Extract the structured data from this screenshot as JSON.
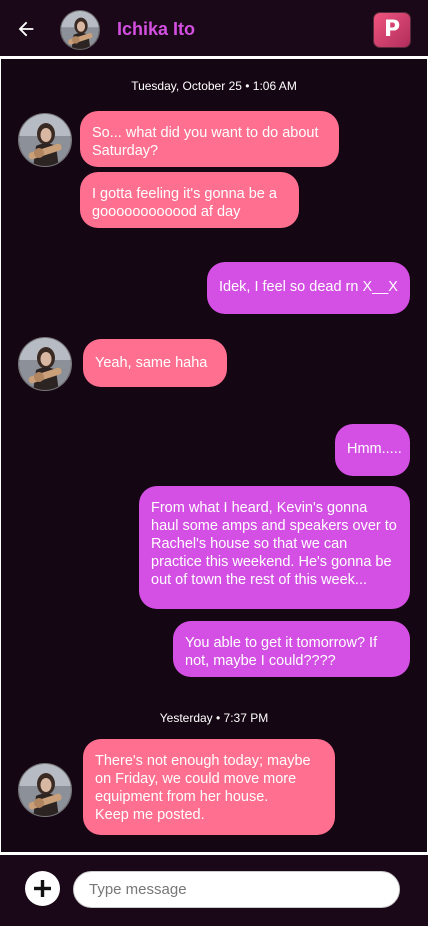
{
  "header": {
    "contact_name": "Ichika Ito",
    "app_logo_letter": "P",
    "back_icon": "arrow-left-icon"
  },
  "thread": {
    "date_separators": [
      "Tuesday, October 25 • 1:06 AM",
      "Yesterday • 7:37 PM"
    ],
    "messages": [
      {
        "side": "incoming",
        "text": "So... what did you want to do about Saturday?"
      },
      {
        "side": "incoming",
        "text": "I gotta feeling it's gonna be a goooooooooood af day"
      },
      {
        "side": "outgoing",
        "text": "Idek, I feel so dead rn X__X"
      },
      {
        "side": "incoming",
        "text": "Yeah, same haha"
      },
      {
        "side": "outgoing",
        "text": "Hmm....."
      },
      {
        "side": "outgoing",
        "text": "From what I heard, Kevin's gonna haul some amps and speakers over to Rachel's house so that we can practice this weekend. He's gonna be out of town the rest of this week..."
      },
      {
        "side": "outgoing",
        "text": "You able to get it tomorrow? If not, maybe I could????"
      },
      {
        "side": "incoming",
        "text": "There's not enough today; maybe on Friday, we could move more equipment from her house.\nKeep me posted."
      }
    ]
  },
  "composer": {
    "placeholder": "Type message",
    "value": "",
    "add_icon": "plus-icon"
  },
  "colors": {
    "incoming_bubble": "#ff6f8f",
    "outgoing_bubble": "#d44fe4",
    "contact_name": "#d34fe0",
    "background": "#150613"
  }
}
